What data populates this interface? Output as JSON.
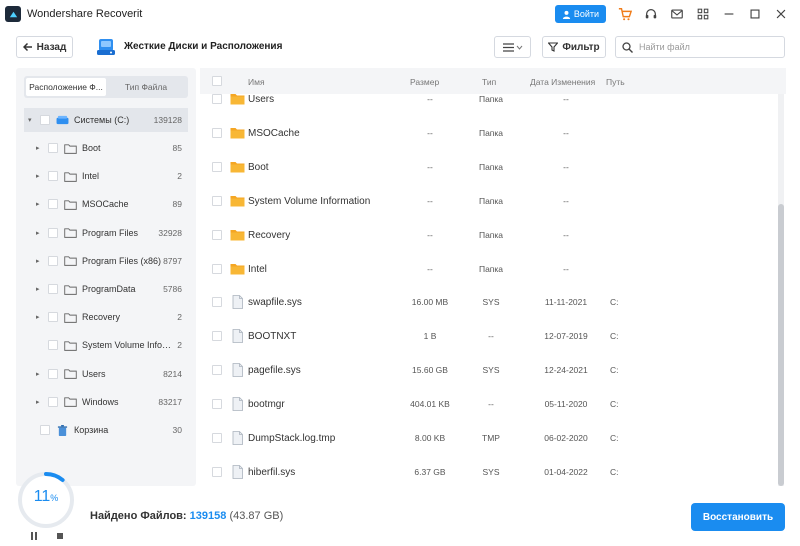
{
  "app": {
    "title": "Wondershare Recoverit",
    "login_label": "Войти"
  },
  "toolbar": {
    "back_label": "Назад",
    "location_title": "Жесткие Диски и Расположения",
    "filter_label": "Фильтр",
    "search_placeholder": "Найти файл"
  },
  "sidebar": {
    "tabs": [
      "Расположение Ф...",
      "Тип Файла"
    ],
    "root": {
      "label": "Системы (C:)",
      "count": "139128"
    },
    "items": [
      {
        "label": "Boot",
        "count": "85",
        "arrow": true
      },
      {
        "label": "Intel",
        "count": "2",
        "arrow": true
      },
      {
        "label": "MSOCache",
        "count": "89",
        "arrow": true
      },
      {
        "label": "Program Files",
        "count": "32928",
        "arrow": true
      },
      {
        "label": "Program Files (x86)",
        "count": "8797",
        "arrow": true
      },
      {
        "label": "ProgramData",
        "count": "5786",
        "arrow": true
      },
      {
        "label": "Recovery",
        "count": "2",
        "arrow": true
      },
      {
        "label": "System Volume Inform...",
        "count": "2",
        "arrow": false
      },
      {
        "label": "Users",
        "count": "8214",
        "arrow": true
      },
      {
        "label": "Windows",
        "count": "83217",
        "arrow": true
      }
    ],
    "trash": {
      "label": "Корзина",
      "count": "30"
    }
  },
  "filelist": {
    "headers": {
      "name": "Имя",
      "size": "Размер",
      "type": "Тип",
      "date": "Дата Изменения",
      "path": "Путь"
    },
    "rows": [
      {
        "name": "Users",
        "size": "--",
        "type": "Папка",
        "date": "--",
        "path": "",
        "kind": "folder"
      },
      {
        "name": "MSOCache",
        "size": "--",
        "type": "Папка",
        "date": "--",
        "path": "",
        "kind": "folder"
      },
      {
        "name": "Boot",
        "size": "--",
        "type": "Папка",
        "date": "--",
        "path": "",
        "kind": "folder"
      },
      {
        "name": "System Volume Information",
        "size": "--",
        "type": "Папка",
        "date": "--",
        "path": "",
        "kind": "folder"
      },
      {
        "name": "Recovery",
        "size": "--",
        "type": "Папка",
        "date": "--",
        "path": "",
        "kind": "folder"
      },
      {
        "name": "Intel",
        "size": "--",
        "type": "Папка",
        "date": "--",
        "path": "",
        "kind": "folder"
      },
      {
        "name": "swapfile.sys",
        "size": "16.00 MB",
        "type": "SYS",
        "date": "11-11-2021",
        "path": "C:",
        "kind": "file"
      },
      {
        "name": "BOOTNXT",
        "size": "1 B",
        "type": "--",
        "date": "12-07-2019",
        "path": "C:",
        "kind": "file"
      },
      {
        "name": "pagefile.sys",
        "size": "15.60 GB",
        "type": "SYS",
        "date": "12-24-2021",
        "path": "C:",
        "kind": "file"
      },
      {
        "name": "bootmgr",
        "size": "404.01 KB",
        "type": "--",
        "date": "05-11-2020",
        "path": "C:",
        "kind": "file"
      },
      {
        "name": "DumpStack.log.tmp",
        "size": "8.00 KB",
        "type": "TMP",
        "date": "06-02-2020",
        "path": "C:",
        "kind": "file"
      },
      {
        "name": "hiberfil.sys",
        "size": "6.37 GB",
        "type": "SYS",
        "date": "01-04-2022",
        "path": "C:",
        "kind": "file"
      }
    ]
  },
  "scan": {
    "progress_value": "11",
    "progress_unit": "%",
    "progress_fraction": 0.11,
    "found_label": "Найдено Файлов:",
    "found_count": "139158",
    "found_size": "(43.87 GB)"
  },
  "restore_label": "Восстановить",
  "colors": {
    "accent": "#1a8cf0",
    "folder": "#f5a623",
    "sidebar_bg": "#f4f5f7"
  }
}
